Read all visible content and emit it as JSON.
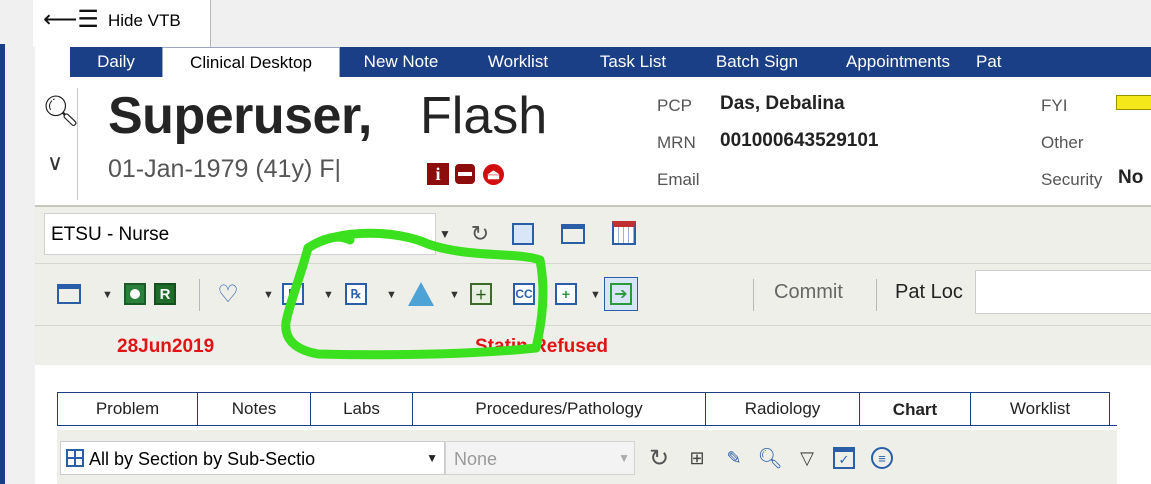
{
  "vtb": {
    "toggle_label": "Hide VTB"
  },
  "nav": {
    "tabs": [
      "Daily",
      "Clinical Desktop",
      "New Note",
      "Worklist",
      "Task List",
      "Batch Sign",
      "Appointments",
      "Pat"
    ],
    "active": "Clinical Desktop"
  },
  "patient": {
    "last_name": "Superuser,",
    "first_name": "Flash",
    "dob_line": "01-Jan-1979 (41y) F|",
    "pcp_label": "PCP",
    "pcp_value": "Das, Debalina",
    "mrn_label": "MRN",
    "mrn_value": "001000643529101",
    "email_label": "Email",
    "fyi_label": "FYI",
    "other_label": "Other",
    "security_label": "Security",
    "security_value": "No",
    "icons": [
      "info-icon",
      "document-icon",
      "alert-icon"
    ]
  },
  "toolbar1": {
    "location": "ETSU - Nurse",
    "icons": [
      "dropdown-arrow-icon",
      "refresh-icon",
      "grid-icon",
      "layout-icon",
      "calendar-icon"
    ]
  },
  "toolbar2": {
    "icons": [
      "layout-icon",
      "person-icon",
      "r-icon",
      "heart-icon",
      "p-icon",
      "rx-icon",
      "flask-icon",
      "order-icon",
      "cc-icon",
      "note-icon",
      "arrow-in-icon"
    ],
    "r_letter": "R",
    "p_letter": "P",
    "cc_letters": "CC",
    "commit_label": "Commit",
    "patloc_label": "Pat Loc",
    "patloc_value": ""
  },
  "alert": {
    "date": "28Jun2019",
    "message": "Statin Refused"
  },
  "chart_tabs": {
    "tabs": [
      "Problem",
      "Notes",
      "Labs",
      "Procedures/Pathology",
      "Radiology",
      "Chart",
      "Worklist"
    ],
    "active": "Chart"
  },
  "chart_toolbar": {
    "view": "All by Section by Sub-Sectio",
    "filter": "None",
    "icons": [
      "refresh-icon",
      "expand-icon",
      "edit-icon",
      "search-icon",
      "filter-icon",
      "calendar-check-icon",
      "list-icon"
    ]
  },
  "colors": {
    "brand_navy": "#1b3f86",
    "alert_red": "#e01414",
    "highlight_green": "#3be01e"
  }
}
